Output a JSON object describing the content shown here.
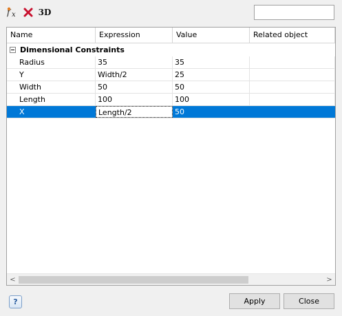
{
  "toolbar": {
    "function_icon": "fx-icon",
    "delete_icon": "red-x-delete-icon",
    "three_d_label": "3D"
  },
  "search": {
    "value": "",
    "placeholder": ""
  },
  "grid": {
    "columns": [
      "Name",
      "Expression",
      "Value",
      "Related object"
    ],
    "group": {
      "label": "Dimensional Constraints",
      "expanded": true
    },
    "rows": [
      {
        "name": "Radius",
        "expression": "35",
        "value": "35",
        "related": ""
      },
      {
        "name": "Y",
        "expression": "Width/2",
        "value": "25",
        "related": ""
      },
      {
        "name": "Width",
        "expression": "50",
        "value": "50",
        "related": ""
      },
      {
        "name": "Length",
        "expression": "100",
        "value": "100",
        "related": ""
      },
      {
        "name": "X",
        "expression": "Length/2",
        "value": "50",
        "related": ""
      }
    ],
    "selected_row_index": 4,
    "selection_color": "#0078d7"
  },
  "scrollbar": {
    "left_arrow": "<",
    "right_arrow": ">"
  },
  "footer": {
    "help_label": "?",
    "apply_label": "Apply",
    "close_label": "Close"
  }
}
